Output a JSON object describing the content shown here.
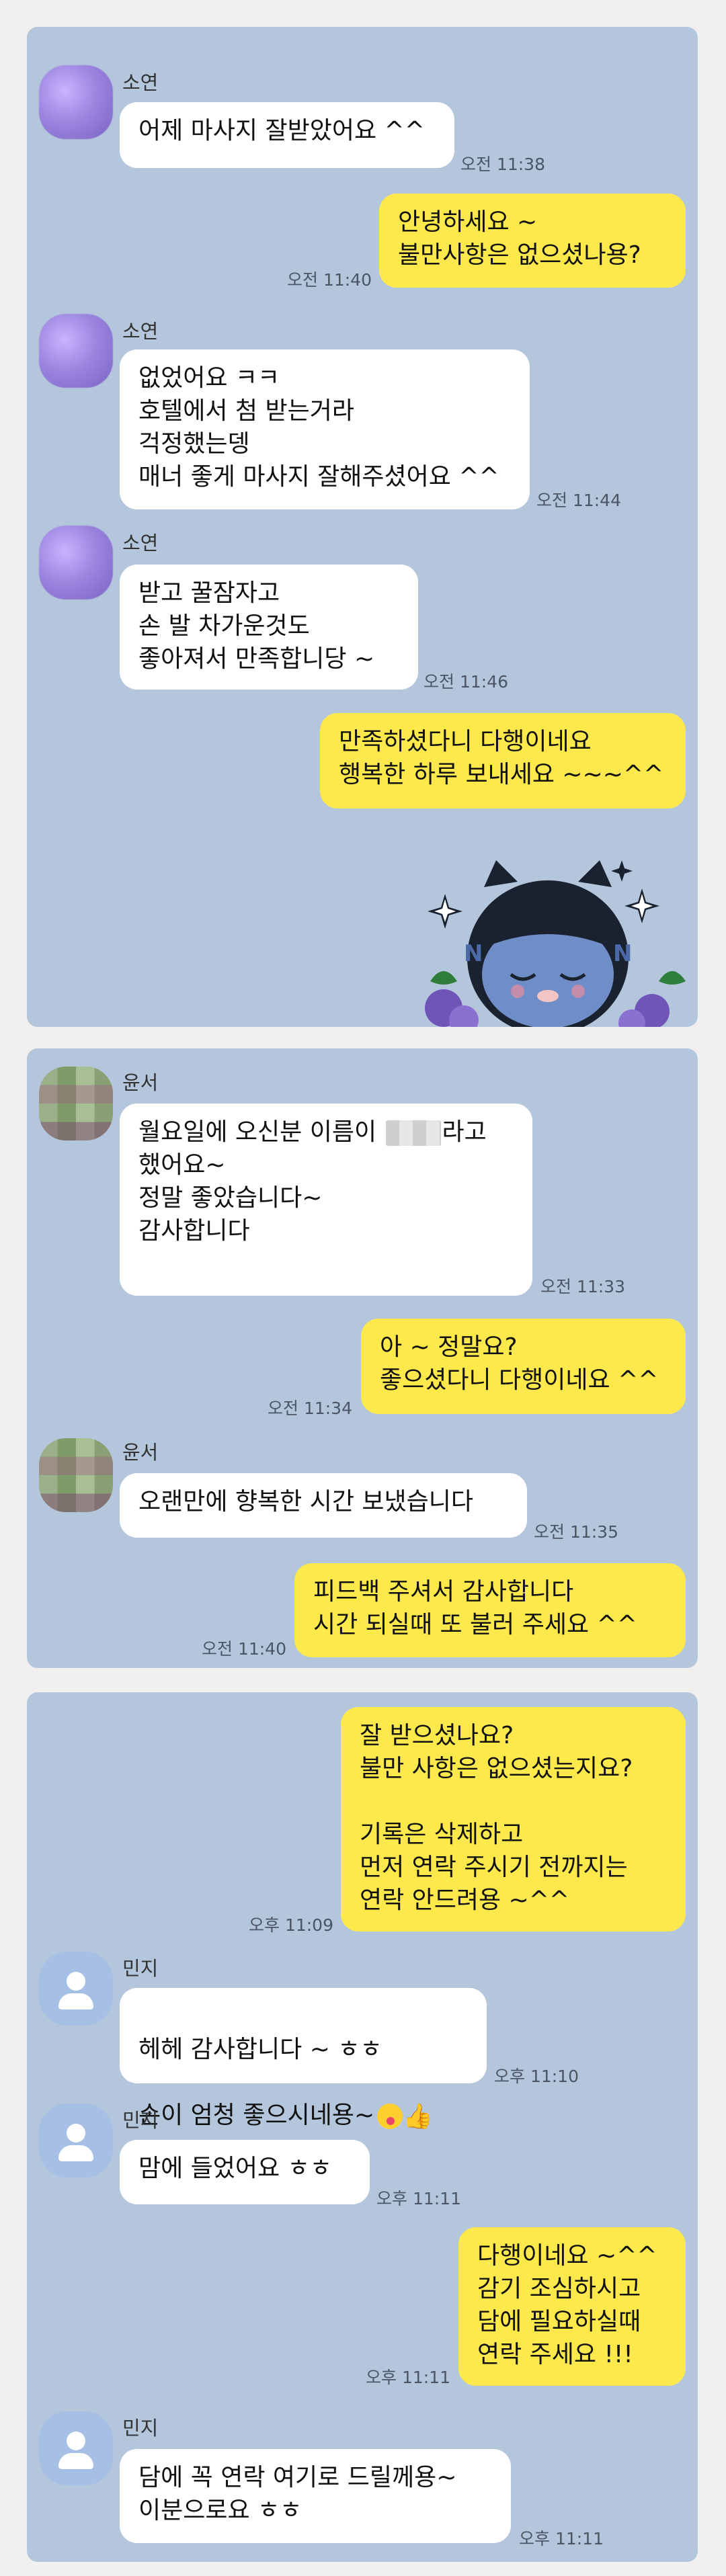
{
  "panel1": {
    "messages": [
      {
        "sender": "소연",
        "text": "어제 마사지 잘받았어요 ^^",
        "time": "오전 11:38"
      },
      {
        "text": "안녕하세요 ~\n불만사항은 없으셨나용?",
        "time": "오전 11:40"
      },
      {
        "sender": "소연",
        "text": "없었어요 ㅋㅋ\n호텔에서 첨 받는거라\n걱정했는뎅\n매너 좋게 마사지 잘해주셨어요 ^^",
        "time": "오전 11:44"
      },
      {
        "sender": "소연",
        "text": "받고 꿀잠자고\n손 발 차가운것도\n좋아져서 만족합니당 ~",
        "time": "오전 11:46"
      },
      {
        "text": "만족하셨다니 다행이네요\n행복한 하루 보내세요 ~~~^^"
      }
    ],
    "sticker": "kakao-neo-sticker"
  },
  "panel2": {
    "messages": [
      {
        "sender": "윤서",
        "text_a": "월요일에 오신분 이름이",
        "text_b": "라고",
        "text_rest": "했어요~\n정말 좋았습니다~\n감사합니다",
        "time": "오전 11:33"
      },
      {
        "text": "아 ~ 정말요?\n좋으셨다니 다행이네요 ^^",
        "time": "오전 11:34"
      },
      {
        "sender": "윤서",
        "text": "오랜만에 향복한 시간 보냈습니다",
        "time": "오전 11:35"
      },
      {
        "text": "피드백 주셔서 감사합니다\n시간 되실때 또 불러 주세요 ^^",
        "time": "오전 11:40"
      }
    ]
  },
  "panel3": {
    "messages": [
      {
        "text": "잘 받으셨나요?\n불만 사항은 없으셨는지요?\n\n기록은 삭제하고\n먼저 연락 주시기 전까지는\n연락 안드려용 ~^^",
        "time": "오후 11:09"
      },
      {
        "sender": "민지",
        "text_a": "헤헤 감사합니다 ~ ㅎㅎ",
        "text_b": "손이 엄청 좋으시네용~",
        "time": "오후 11:10"
      },
      {
        "sender": "민지",
        "text": "맘에 들었어요 ㅎㅎ",
        "time": "오후 11:11"
      },
      {
        "text": "다행이네요 ~^^\n감기 조심하시고\n담에 필요하실때\n연락 주세요 !!!",
        "time": "오후 11:11"
      },
      {
        "sender": "민지",
        "text": "담에 꼭 연락 여기로 드릴께용~\n이분으로요 ㅎㅎ",
        "time": "오후 11:11"
      }
    ]
  },
  "colors": {
    "background": "#b4c6dc",
    "my_bubble": "#fee94d",
    "their_bubble": "#ffffff"
  }
}
